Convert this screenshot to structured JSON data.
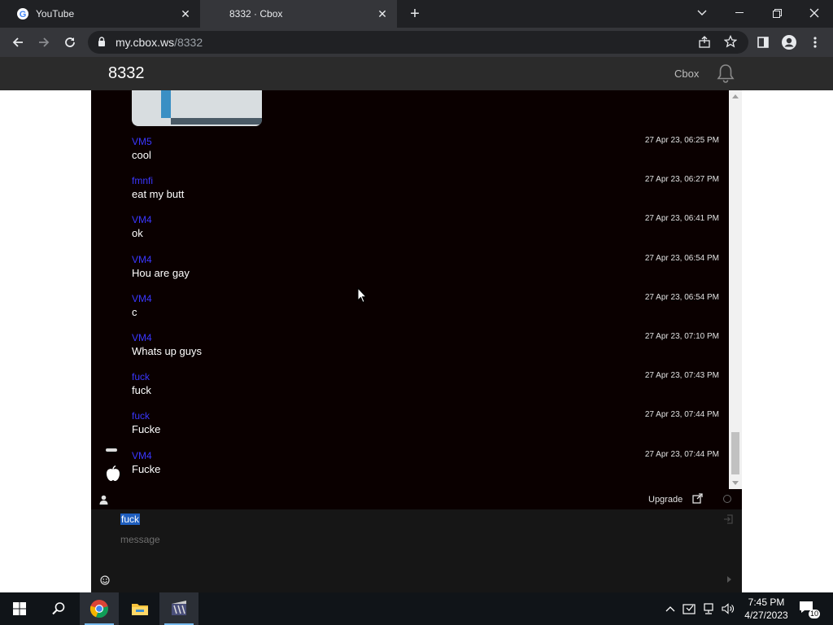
{
  "browser": {
    "tabs": [
      {
        "title": "YouTube",
        "active": false
      },
      {
        "title": "8332 · Cbox",
        "active": true
      }
    ],
    "url_domain": "my.cbox.ws",
    "url_path": "/8332"
  },
  "cbox": {
    "title": "8332",
    "brand_link": "Cbox"
  },
  "messages": [
    {
      "user": "VM5",
      "text": "cool",
      "time": "27 Apr 23, 06:25 PM"
    },
    {
      "user": "fmnfi",
      "text": "eat my butt",
      "time": "27 Apr 23, 06:27 PM"
    },
    {
      "user": "VM4",
      "text": "ok",
      "time": "27 Apr 23, 06:41 PM"
    },
    {
      "user": "VM4",
      "text": "Hou are gay",
      "time": "27 Apr 23, 06:54 PM"
    },
    {
      "user": "VM4",
      "text": "c",
      "time": "27 Apr 23, 06:54 PM"
    },
    {
      "user": "VM4",
      "text": "Whats up guys",
      "time": "27 Apr 23, 07:10 PM"
    },
    {
      "user": "fuck",
      "text": "fuck",
      "time": "27 Apr 23, 07:43 PM"
    },
    {
      "user": "fuck",
      "text": "Fucke",
      "time": "27 Apr 23, 07:44 PM"
    },
    {
      "user": "VM4",
      "text": "Fucke",
      "time": "27 Apr 23, 07:44 PM"
    }
  ],
  "footer": {
    "upgrade_label": "Upgrade"
  },
  "input": {
    "name_value": "fuck",
    "message_placeholder": "message"
  },
  "taskbar": {
    "time": "7:45 PM",
    "date": "4/27/2023",
    "notification_count": "10"
  },
  "colors": {
    "username": "#3a37ff",
    "chat_bg": "#0a0000",
    "header_bg": "#2b2b2b"
  }
}
